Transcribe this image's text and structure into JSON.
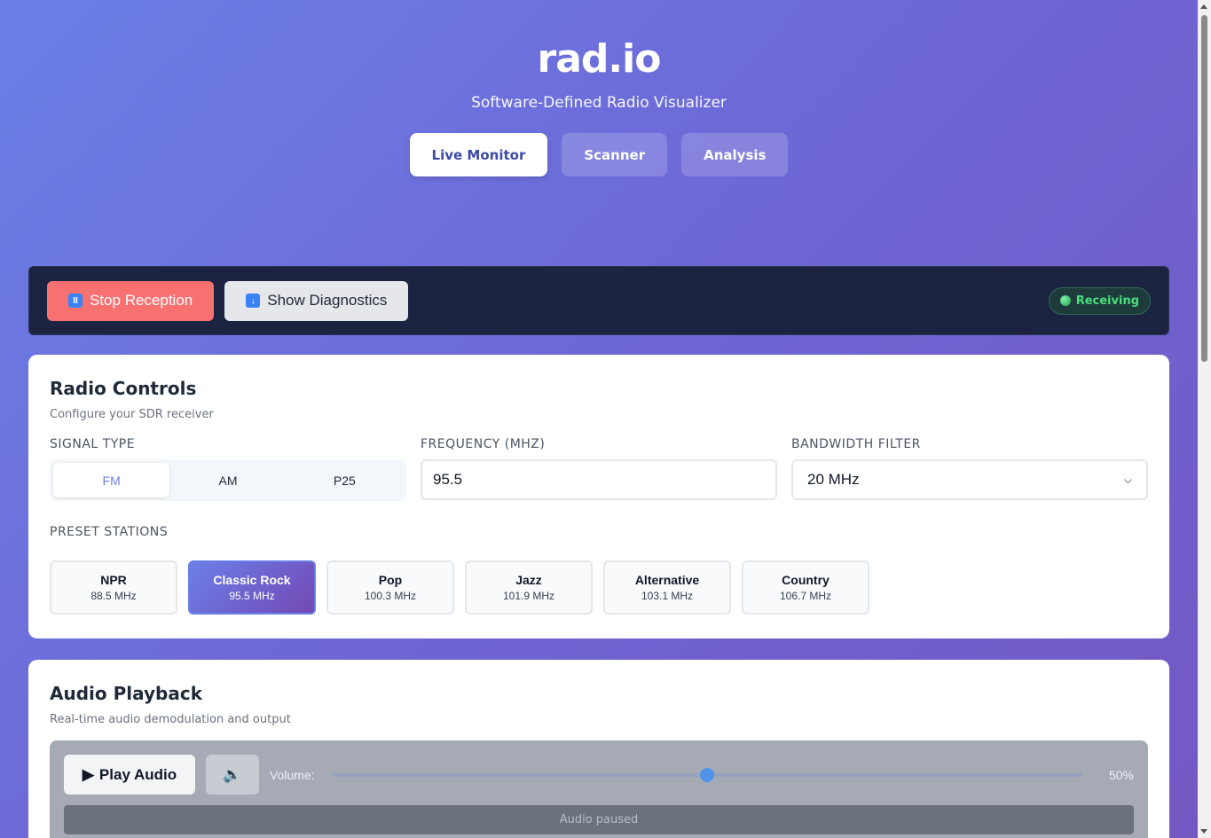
{
  "header": {
    "title": "rad.io",
    "subtitle": "Software-Defined Radio Visualizer",
    "tabs": [
      {
        "label": "Live Monitor",
        "active": true
      },
      {
        "label": "Scanner",
        "active": false
      },
      {
        "label": "Analysis",
        "active": false
      }
    ]
  },
  "toolbar": {
    "stop_label": "Stop Reception",
    "stop_icon": "pause-icon",
    "diagnostics_label": "Show Diagnostics",
    "diagnostics_icon": "down-arrow-icon",
    "status": "Receiving",
    "status_color": "#4ade80"
  },
  "radio_controls": {
    "title": "Radio Controls",
    "subtitle": "Configure your SDR receiver",
    "signal_type_label": "SIGNAL TYPE",
    "signal_types": [
      "FM",
      "AM",
      "P25"
    ],
    "signal_type_selected": "FM",
    "frequency_label": "FREQUENCY (MHZ)",
    "frequency_value": "95.5",
    "bandwidth_label": "BANDWIDTH FILTER",
    "bandwidth_value": "20 MHz",
    "presets_label": "PRESET STATIONS",
    "presets": [
      {
        "name": "NPR",
        "freq": "88.5 MHz"
      },
      {
        "name": "Classic Rock",
        "freq": "95.5 MHz"
      },
      {
        "name": "Pop",
        "freq": "100.3 MHz"
      },
      {
        "name": "Jazz",
        "freq": "101.9 MHz"
      },
      {
        "name": "Alternative",
        "freq": "103.1 MHz"
      },
      {
        "name": "Country",
        "freq": "106.7 MHz"
      }
    ],
    "preset_selected": "Classic Rock"
  },
  "audio": {
    "title": "Audio Playback",
    "subtitle": "Real-time audio demodulation and output",
    "play_label": "Play Audio",
    "volume_label": "Volume:",
    "volume_value": "50%",
    "volume_fraction": 0.5,
    "status": "Audio paused"
  },
  "colors": {
    "accent": "#6b7fe8",
    "stop": "#f87171",
    "toolbar_bg": "#1b2340"
  }
}
